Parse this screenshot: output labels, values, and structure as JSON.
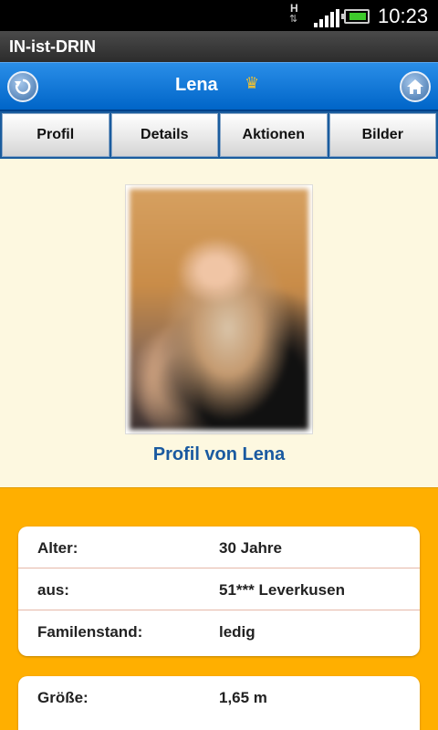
{
  "status_bar": {
    "network_label": "H",
    "time": "10:23",
    "signal_icon": "signal-bars-icon",
    "battery_icon": "battery-icon"
  },
  "app": {
    "title": "IN-ist-DRIN"
  },
  "header": {
    "name": "Lena",
    "crown_icon": "crown-icon",
    "back_icon": "back-icon",
    "home_icon": "home-icon"
  },
  "tabs": [
    {
      "label": "Profil"
    },
    {
      "label": "Details"
    },
    {
      "label": "Aktionen"
    },
    {
      "label": "Bilder"
    }
  ],
  "profile": {
    "caption": "Profil von Lena"
  },
  "details": {
    "card1": [
      {
        "key": "Alter:",
        "value": "30 Jahre"
      },
      {
        "key": "aus:",
        "value": "51*** Leverkusen"
      },
      {
        "key": "Familenstand:",
        "value": "ledig"
      }
    ],
    "card2": [
      {
        "key": "Größe:",
        "value": "1,65 m"
      }
    ]
  },
  "colors": {
    "header_blue": "#0a78dc",
    "profile_bg": "#fdf8e0",
    "details_bg": "#ffaf00",
    "caption_blue": "#1a5aa0"
  }
}
